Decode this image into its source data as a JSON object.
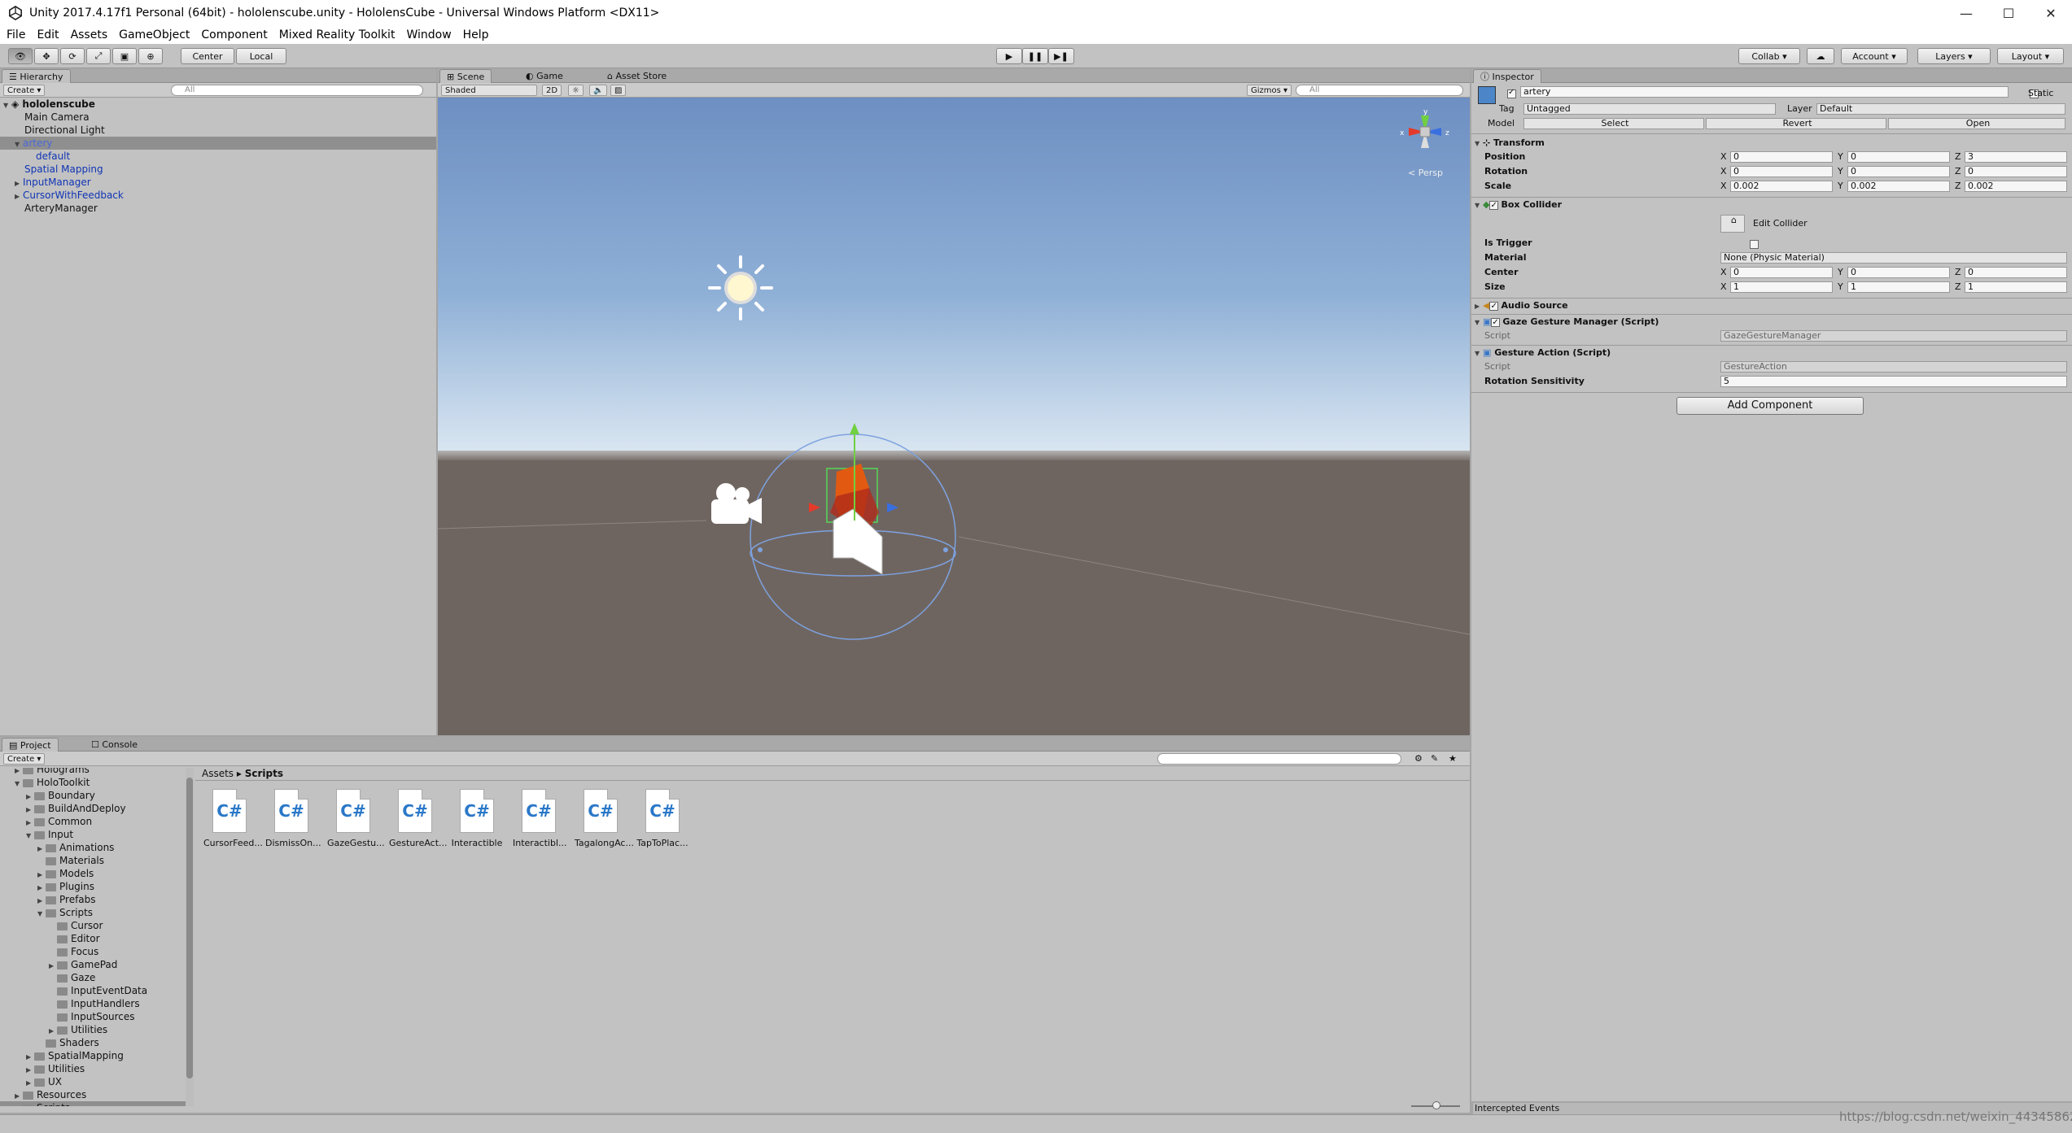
{
  "window": {
    "title": "Unity 2017.4.17f1 Personal (64bit) - hololenscube.unity - HololensCube - Universal Windows Platform <DX11>"
  },
  "menu": [
    "File",
    "Edit",
    "Assets",
    "GameObject",
    "Component",
    "Mixed Reality Toolkit",
    "Window",
    "Help"
  ],
  "toolbar": {
    "center": "Center",
    "local": "Local",
    "collab": "Collab ▾",
    "account": "Account ▾",
    "layers": "Layers ▾",
    "layout": "Layout ▾"
  },
  "hierarchy": {
    "tab": "Hierarchy",
    "create": "Create ▾",
    "search": "All",
    "scene": "hololenscube",
    "items": [
      "Main Camera",
      "Directional Light",
      "artery",
      "default",
      "Spatial Mapping",
      "InputManager",
      "CursorWithFeedback",
      "ArteryManager"
    ]
  },
  "scene": {
    "tabs": [
      "Scene",
      "Game",
      "Asset Store"
    ],
    "shading": "Shaded",
    "mode2d": "2D",
    "gizmos": "Gizmos ▾",
    "search": "All",
    "persp": "< Persp"
  },
  "inspector": {
    "tab": "Inspector",
    "name": "artery",
    "static": "Static",
    "tag_label": "Tag",
    "tag": "Untagged",
    "layer_label": "Layer",
    "layer": "Default",
    "model_label": "Model",
    "model_buttons": [
      "Select",
      "Revert",
      "Open"
    ],
    "transform": {
      "title": "Transform",
      "position": {
        "label": "Position",
        "x": "0",
        "y": "0",
        "z": "3"
      },
      "rotation": {
        "label": "Rotation",
        "x": "0",
        "y": "0",
        "z": "0"
      },
      "scale": {
        "label": "Scale",
        "x": "0.002",
        "y": "0.002",
        "z": "0.002"
      }
    },
    "box_collider": {
      "title": "Box Collider",
      "edit": "Edit Collider",
      "is_trigger": "Is Trigger",
      "material_label": "Material",
      "material": "None (Physic Material)",
      "center": {
        "label": "Center",
        "x": "0",
        "y": "0",
        "z": "0"
      },
      "size": {
        "label": "Size",
        "x": "1",
        "y": "1",
        "z": "1"
      }
    },
    "audio_source": "Audio Source",
    "gaze": {
      "title": "Gaze Gesture Manager (Script)",
      "script_label": "Script",
      "script": "GazeGestureManager"
    },
    "gesture": {
      "title": "Gesture Action (Script)",
      "script_label": "Script",
      "script": "GestureAction",
      "rot_label": "Rotation Sensitivity",
      "rot": "5"
    },
    "add_component": "Add Component"
  },
  "project": {
    "tabs": [
      "Project",
      "Console"
    ],
    "create": "Create ▾",
    "breadcrumb": [
      "Assets",
      "Scripts"
    ],
    "tree": [
      {
        "label": "Holograms",
        "indent": 1,
        "arrow": "▶"
      },
      {
        "label": "HoloToolkit",
        "indent": 1,
        "arrow": "▼"
      },
      {
        "label": "Boundary",
        "indent": 2,
        "arrow": "▶"
      },
      {
        "label": "BuildAndDeploy",
        "indent": 2,
        "arrow": "▶"
      },
      {
        "label": "Common",
        "indent": 2,
        "arrow": "▶"
      },
      {
        "label": "Input",
        "indent": 2,
        "arrow": "▼"
      },
      {
        "label": "Animations",
        "indent": 3,
        "arrow": "▶"
      },
      {
        "label": "Materials",
        "indent": 3,
        "arrow": ""
      },
      {
        "label": "Models",
        "indent": 3,
        "arrow": "▶"
      },
      {
        "label": "Plugins",
        "indent": 3,
        "arrow": "▶"
      },
      {
        "label": "Prefabs",
        "indent": 3,
        "arrow": "▶"
      },
      {
        "label": "Scripts",
        "indent": 3,
        "arrow": "▼"
      },
      {
        "label": "Cursor",
        "indent": 4,
        "arrow": ""
      },
      {
        "label": "Editor",
        "indent": 4,
        "arrow": ""
      },
      {
        "label": "Focus",
        "indent": 4,
        "arrow": ""
      },
      {
        "label": "GamePad",
        "indent": 4,
        "arrow": "▶"
      },
      {
        "label": "Gaze",
        "indent": 4,
        "arrow": ""
      },
      {
        "label": "InputEventData",
        "indent": 4,
        "arrow": ""
      },
      {
        "label": "InputHandlers",
        "indent": 4,
        "arrow": ""
      },
      {
        "label": "InputSources",
        "indent": 4,
        "arrow": ""
      },
      {
        "label": "Utilities",
        "indent": 4,
        "arrow": "▶"
      },
      {
        "label": "Shaders",
        "indent": 3,
        "arrow": ""
      },
      {
        "label": "SpatialMapping",
        "indent": 2,
        "arrow": "▶"
      },
      {
        "label": "Utilities",
        "indent": 2,
        "arrow": "▶"
      },
      {
        "label": "UX",
        "indent": 2,
        "arrow": "▶"
      },
      {
        "label": "Resources",
        "indent": 1,
        "arrow": "▶"
      },
      {
        "label": "Scripts",
        "indent": 1,
        "arrow": ""
      }
    ],
    "files": [
      "CursorFeed...",
      "DismissOn...",
      "GazeGestu...",
      "GestureAct...",
      "Interactible",
      "Interactibl...",
      "TagalongAc...",
      "TapToPlac..."
    ]
  },
  "status": {
    "intercepted": "Intercepted Events",
    "watermark": "https://blog.csdn.net/weixin_44345862"
  }
}
